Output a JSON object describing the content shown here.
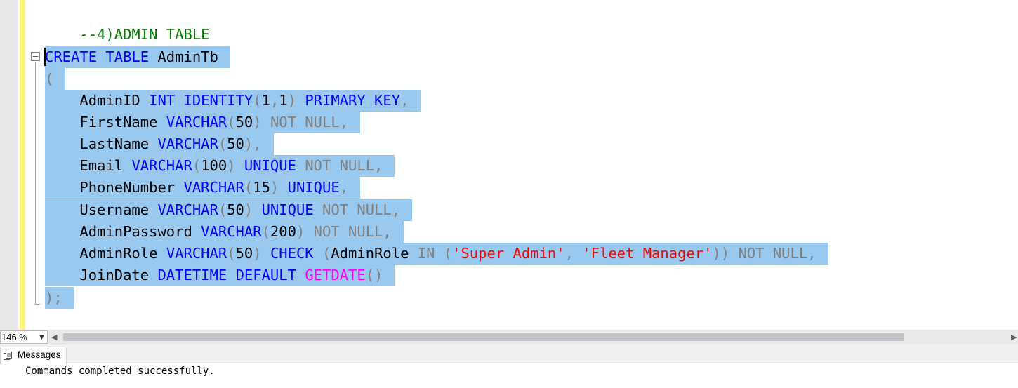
{
  "editor": {
    "comment": "--4)ADMIN TABLE",
    "lines": {
      "create": {
        "kw1": "CREATE",
        "kw2": "TABLE",
        "name": "AdminTb"
      },
      "open_paren": "(",
      "admin_id": {
        "col": "AdminID",
        "type": "INT",
        "identity": "IDENTITY",
        "args_open": "(",
        "arg1": "1",
        "comma": ",",
        "arg2": "1",
        "args_close": ")",
        "pk": "PRIMARY KEY",
        "tail": ","
      },
      "first_name": {
        "col": "FirstName",
        "type": "VARCHAR",
        "open": "(",
        "len": "50",
        "close": ")",
        "nn": "NOT NULL,"
      },
      "last_name": {
        "col": "LastName",
        "type": "VARCHAR",
        "open": "(",
        "len": "50",
        "close": "),"
      },
      "email": {
        "col": "Email",
        "type": "VARCHAR",
        "open": "(",
        "len": "100",
        "close": ")",
        "uq": "UNIQUE",
        "nn": "NOT NULL,"
      },
      "phone": {
        "col": "PhoneNumber",
        "type": "VARCHAR",
        "open": "(",
        "len": "15",
        "close": ")",
        "uq": "UNIQUE",
        "tail": ","
      },
      "username": {
        "col": "Username",
        "type": "VARCHAR",
        "open": "(",
        "len": "50",
        "close": ")",
        "uq": "UNIQUE",
        "nn": "NOT NULL,"
      },
      "password": {
        "col": "AdminPassword",
        "type": "VARCHAR",
        "open": "(",
        "len": "200",
        "close": ")",
        "nn": "NOT NULL,"
      },
      "role": {
        "col": "AdminRole",
        "type": "VARCHAR",
        "open": "(",
        "len": "50",
        "close": ")",
        "check": "CHECK",
        "cparen": "(",
        "ref": "AdminRole",
        "in": "IN (",
        "s1": "'Super Admin'",
        "sep": ", ",
        "s2": "'Fleet Manager'",
        "close2": "))",
        "nn": "NOT NULL,"
      },
      "join_date": {
        "col": "JoinDate",
        "type": "DATETIME",
        "def": "DEFAULT",
        "fn": "GETDATE",
        "parens": "()"
      },
      "close": ");"
    }
  },
  "status": {
    "zoom": "146 %"
  },
  "results": {
    "tab_label": "Messages",
    "message": "Commands completed successfully."
  }
}
